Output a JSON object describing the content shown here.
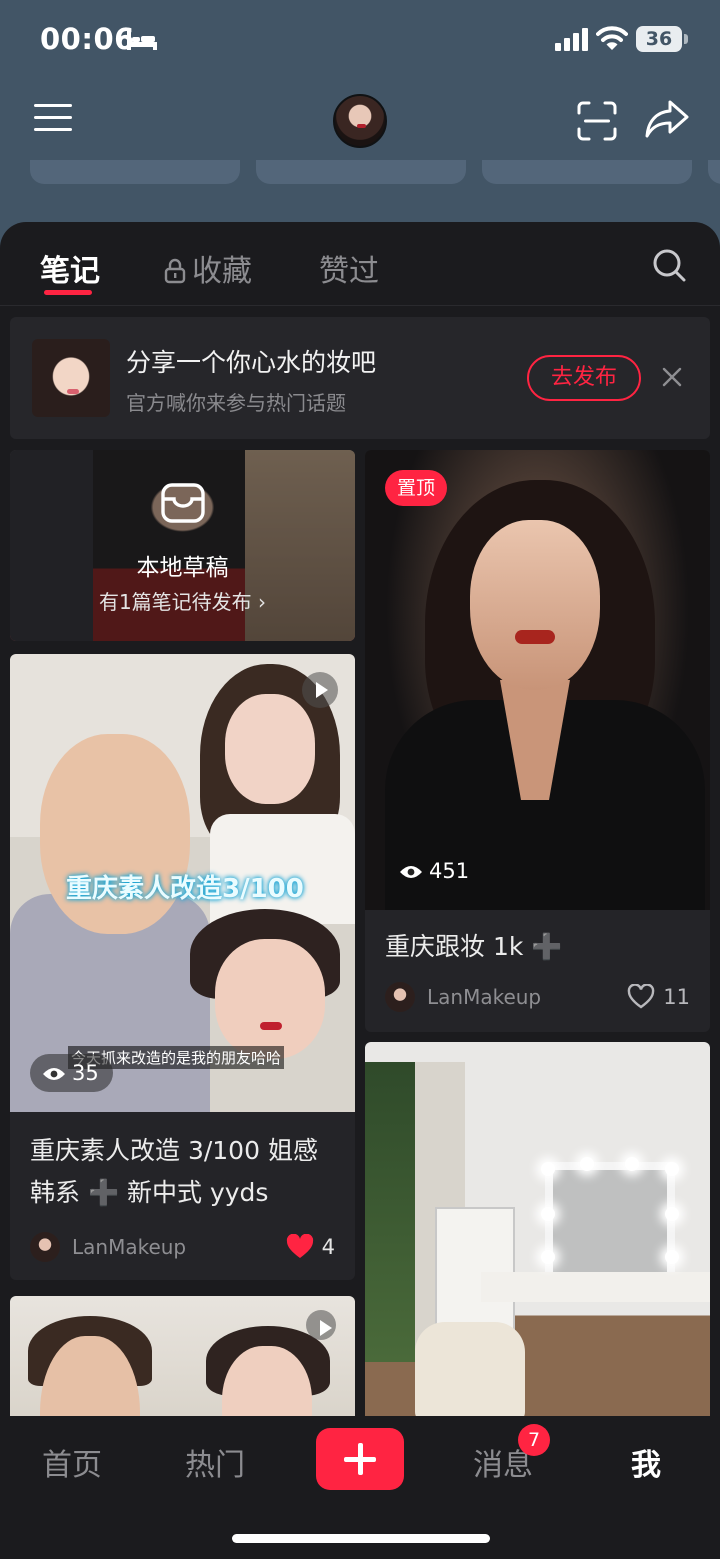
{
  "status_bar": {
    "time": "00:06",
    "battery": "36",
    "icons": [
      "bed-icon",
      "signal-icon",
      "wifi-icon",
      "battery-icon"
    ]
  },
  "header": {
    "icons": [
      "menu-icon",
      "profile-avatar",
      "scan-icon",
      "share-icon"
    ]
  },
  "tabs": [
    {
      "label": "笔记",
      "active": true
    },
    {
      "label": "收藏",
      "locked": true
    },
    {
      "label": "赞过"
    }
  ],
  "banner": {
    "title": "分享一个你心水的妆吧",
    "subtitle": "官方喊你来参与热门话题",
    "button_label": "去发布"
  },
  "draft": {
    "title": "本地草稿",
    "subtitle": "有1篇笔记待发布 ›"
  },
  "notes": [
    {
      "image_text": "重庆素人改造3/100",
      "image_caption": "今天抓来改造的是我的朋友哈哈",
      "views": "35",
      "title_line1": "重庆素人改造 3/100 姐感",
      "title_line2": "韩系 ➕ 新中式 yyds",
      "user": "LanMakeup",
      "likes": "4",
      "liked": true
    },
    {
      "badge": "置顶",
      "views": "451",
      "title": "重庆跟妆 1k ➕",
      "user": "LanMakeup",
      "likes": "11",
      "liked": false
    }
  ],
  "bottom_nav": [
    {
      "label": "首页"
    },
    {
      "label": "热门"
    },
    {
      "label": "+",
      "icon": "plus-icon"
    },
    {
      "label": "消息",
      "badge": "7"
    },
    {
      "label": "我",
      "active": true
    }
  ],
  "colors": {
    "accent": "#ff2442",
    "header_bg": "#425566",
    "page_bg": "#1b1b1e",
    "card_bg": "#242428"
  }
}
